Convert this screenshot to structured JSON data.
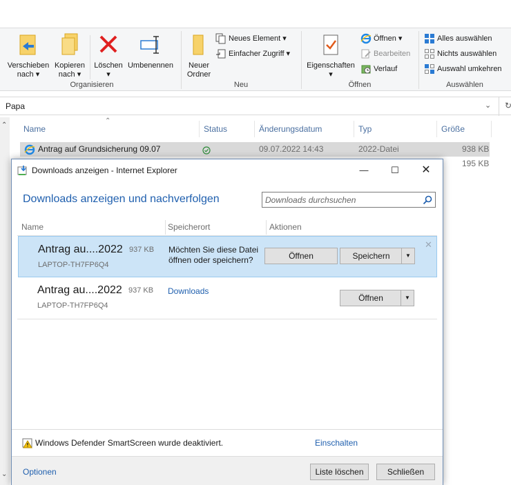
{
  "ribbon": {
    "organisieren": {
      "verschieben": "Verschieben\nnach ▾",
      "kopieren": "Kopieren\nnach ▾",
      "loeschen": "Löschen\n▾",
      "umbenennen": "Umbenennen",
      "group": "Organisieren"
    },
    "neu": {
      "neuer_ordner": "Neuer\nOrdner",
      "neues_element": "Neues Element ▾",
      "einfacher_zugriff": "Einfacher Zugriff ▾",
      "group": "Neu"
    },
    "oeffnen": {
      "eigenschaften": "Eigenschaften\n▾",
      "oeffnen": "Öffnen ▾",
      "bearbeiten": "Bearbeiten",
      "verlauf": "Verlauf",
      "group": "Öffnen"
    },
    "auswaehlen": {
      "alles": "Alles auswählen",
      "nichts": "Nichts auswählen",
      "umkehren": "Auswahl umkehren",
      "group": "Auswählen"
    }
  },
  "address": {
    "path": "Papa"
  },
  "columns": {
    "name": "Name",
    "status": "Status",
    "date": "Änderungsdatum",
    "type": "Typ",
    "size": "Größe"
  },
  "files": [
    {
      "name": "Antrag auf Grundsicherung 09.07",
      "date": "09.07.2022 14:43",
      "type": "2022-Datei",
      "size": "938 KB"
    },
    {
      "size": "195 KB"
    }
  ],
  "dialog": {
    "title": "Downloads anzeigen - Internet Explorer",
    "heading": "Downloads anzeigen und nachverfolgen",
    "search_placeholder": "Downloads durchsuchen",
    "cols": {
      "name": "Name",
      "location": "Speicherort",
      "actions": "Aktionen"
    },
    "items": [
      {
        "name": "Antrag au....2022",
        "size": "937 KB",
        "host": "LAPTOP-TH7FP6Q4",
        "message": "Möchten Sie diese Datei öffnen oder speichern?",
        "open": "Öffnen",
        "save": "Speichern"
      },
      {
        "name": "Antrag au....2022",
        "size": "937 KB",
        "host": "LAPTOP-TH7FP6Q4",
        "location": "Downloads",
        "open": "Öffnen"
      }
    ],
    "smartscreen": "Windows Defender SmartScreen wurde deaktiviert.",
    "enable": "Einschalten",
    "options": "Optionen",
    "clear_list": "Liste löschen",
    "close": "Schließen"
  }
}
